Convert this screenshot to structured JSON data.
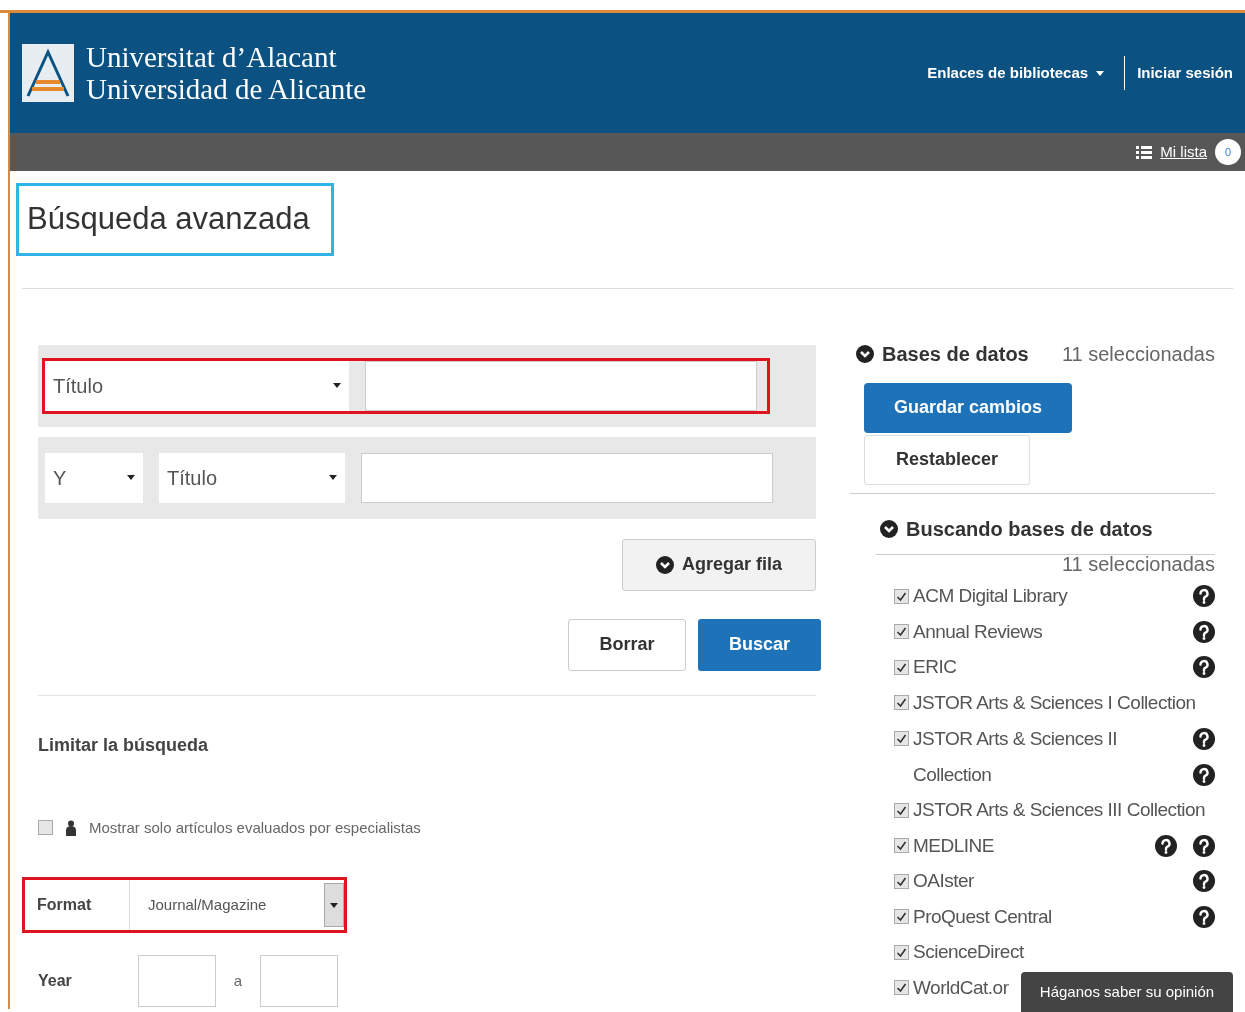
{
  "header": {
    "university_lines": [
      "Universitat d’Alacant",
      "Universidad de Alicante"
    ],
    "nav": [
      {
        "label": "Enlaces de bibliotecas",
        "kind": "dropdown"
      },
      {
        "label": "Iniciar sesión",
        "kind": "link"
      }
    ]
  },
  "sub_bar": {
    "my_list": "Mi lista",
    "count": "0"
  },
  "page_title": "Búsqueda avanzada",
  "search_rows": [
    {
      "operator": null,
      "field": "Título",
      "value": "",
      "focused": true
    },
    {
      "operator": "Y",
      "field": "Título",
      "value": "",
      "focused": false
    }
  ],
  "buttons": {
    "add_row": "Agregar fila",
    "clear": "Borrar",
    "search": "Buscar"
  },
  "limit": {
    "title": "Limitar la búsqueda",
    "peer_review": {
      "label": "Mostrar solo artículos evaluados por especialistas",
      "checked": false
    },
    "format": {
      "label": "Format",
      "value": "Journal/Magazine"
    },
    "year": {
      "label": "Year",
      "separator": "a"
    }
  },
  "databases": {
    "title": "Bases de datos",
    "count": "11 seleccionadas",
    "save": "Guardar cambios",
    "reset": "Restablecer",
    "searching_title": "Buscando bases de datos",
    "searching_count": "11 seleccionadas",
    "items": [
      {
        "name": "ACM Digital Library",
        "checked": true,
        "kind": "help"
      },
      {
        "name": "Annual Reviews",
        "checked": true,
        "kind": "help"
      },
      {
        "name": "ERIC",
        "checked": true,
        "kind": "help"
      },
      {
        "name": "JSTOR Arts & Sciences I Collection",
        "checked": true,
        "kind": "plain"
      },
      {
        "name": "JSTOR Arts & Sciences II Collection",
        "checked": true,
        "kind": "wrapped"
      },
      {
        "name": "JSTOR Arts & Sciences III Collection",
        "checked": true,
        "kind": "plain"
      },
      {
        "name": "MEDLINE",
        "checked": true,
        "kind": "double"
      },
      {
        "name": "OAIster",
        "checked": true,
        "kind": "help"
      },
      {
        "name": "ProQuest Central",
        "checked": true,
        "kind": "help"
      },
      {
        "name": "ScienceDirect",
        "checked": true,
        "kind": "plain"
      },
      {
        "name": "WorldCat.or",
        "checked": true,
        "kind": "plain"
      }
    ]
  },
  "feedback": "Háganos saber su opinión"
}
